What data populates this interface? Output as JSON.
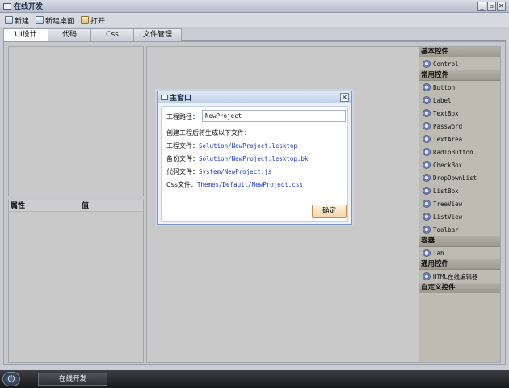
{
  "window": {
    "title": "在线开发",
    "controls": [
      "_",
      "▫",
      "✕"
    ]
  },
  "toolbar": {
    "new_label": "新建",
    "new_desktop_label": "新建桌面",
    "open_label": "打开"
  },
  "tabs": [
    "UI设计",
    "代码",
    "Css",
    "文件管理"
  ],
  "properties": {
    "col_property": "属性",
    "col_value": "值"
  },
  "controls_panel": {
    "basic_title": "基本控件",
    "basic_items": [
      "Control"
    ],
    "common_title": "常用控件",
    "common_items": [
      "Button",
      "Label",
      "TextBox",
      "Password",
      "TextArea",
      "RadioButton",
      "CheckBox",
      "DropDownList",
      "ListBox",
      "TreeView",
      "ListView",
      "Toolbar"
    ],
    "container_title": "容器",
    "container_items": [
      "Tab"
    ],
    "general_title": "通用控件",
    "general_items": [
      "HTML在线编辑器"
    ],
    "custom_title": "自定义控件"
  },
  "dialog": {
    "title": "主窗口",
    "path_label": "工程路径：",
    "path_value": "NewProject",
    "info_text": "创建工程后将生成以下文件：",
    "project_file_label": "工程文件：",
    "project_file_value": "Solution/NewProject.lesktop",
    "backup_file_label": "备份文件：",
    "backup_file_value": "Solution/NewProject.lesktop.bk",
    "code_file_label": "代码文件：",
    "code_file_value": "System/NewProject.js",
    "css_file_label": "Css文件：",
    "css_file_value": "Themes/Default/NewProject.css",
    "ok_label": "确定"
  },
  "taskbar": {
    "start_glyph": "⏻",
    "item_label": "在线开发"
  }
}
